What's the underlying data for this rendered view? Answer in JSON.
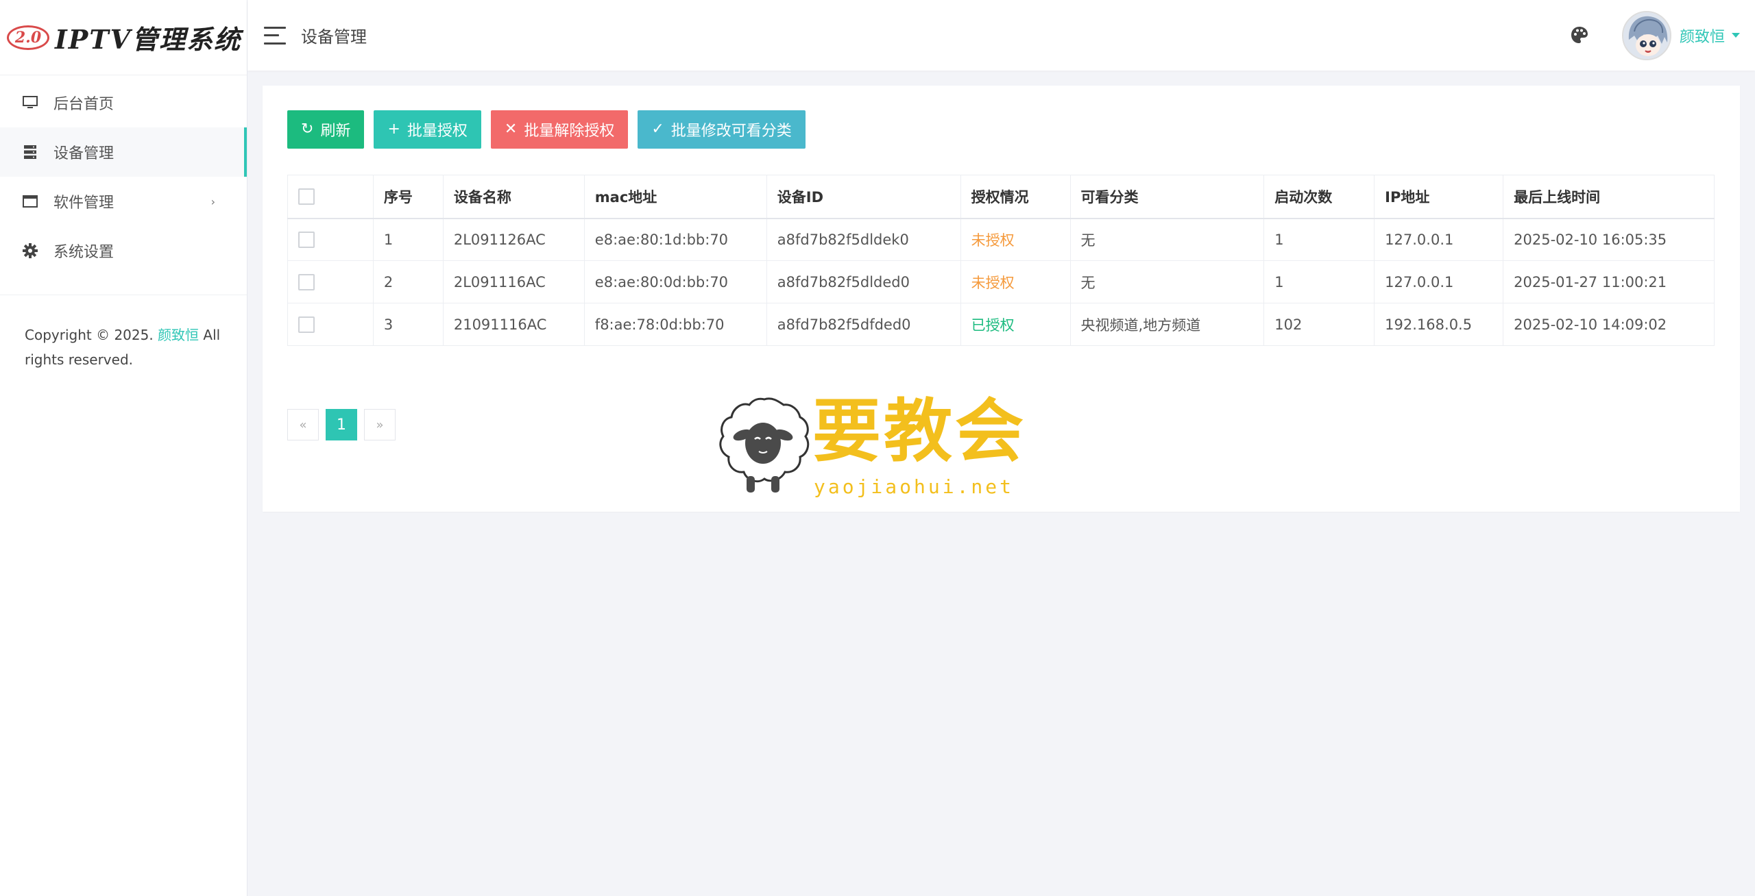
{
  "logo": {
    "badge": "2.0",
    "title": "IPTV管理系统"
  },
  "sidebar": {
    "items": [
      {
        "label": "后台首页",
        "icon": "monitor-icon"
      },
      {
        "label": "设备管理",
        "icon": "server-icon",
        "active": true
      },
      {
        "label": "软件管理",
        "icon": "window-icon",
        "has_submenu": true,
        "arrow": "›"
      },
      {
        "label": "系统设置",
        "icon": "gear-icon"
      }
    ],
    "copyright": {
      "prefix": "Copyright © 2025. ",
      "author": "颜致恒",
      "suffix": " All rights reserved."
    }
  },
  "header": {
    "title": "设备管理",
    "username": "颜致恒",
    "theme_icon": "palette-icon"
  },
  "toolbar": {
    "refresh": {
      "icon": "↻",
      "label": "刷新"
    },
    "batch_auth": {
      "icon": "+",
      "label": "批量授权"
    },
    "batch_unauth": {
      "icon": "✕",
      "label": "批量解除授权"
    },
    "batch_category": {
      "icon": "✓",
      "label": "批量修改可看分类"
    }
  },
  "table": {
    "columns": [
      "序号",
      "设备名称",
      "mac地址",
      "设备ID",
      "授权情况",
      "可看分类",
      "启动次数",
      "IP地址",
      "最后上线时间"
    ],
    "rows": [
      [
        "1",
        "2L091126AC",
        "e8:ae:80:1d:bb:70",
        "a8fd7b82f5dldek0",
        "未授权",
        "无",
        "1",
        "127.0.0.1",
        "2025-02-10 16:05:35"
      ],
      [
        "2",
        "2L091116AC",
        "e8:ae:80:0d:bb:70",
        "a8fd7b82f5dlded0",
        "未授权",
        "无",
        "1",
        "127.0.0.1",
        "2025-01-27 11:00:21"
      ],
      [
        "3",
        "21091116AC",
        "f8:ae:78:0d:bb:70",
        "a8fd7b82f5dfded0",
        "已授权",
        "央视频道,地方频道",
        "102",
        "192.168.0.5",
        "2025-02-10 14:09:02"
      ]
    ]
  },
  "pagination": {
    "prev": "«",
    "current": "1",
    "next": "»"
  },
  "watermark": {
    "cn": "要教会",
    "en": "yaojiaohui.net"
  },
  "colors": {
    "accent": "#2fc6b6",
    "unauthorized": "#f59a3c",
    "authorized": "#1cbb7f",
    "danger": "#f26a6a"
  }
}
